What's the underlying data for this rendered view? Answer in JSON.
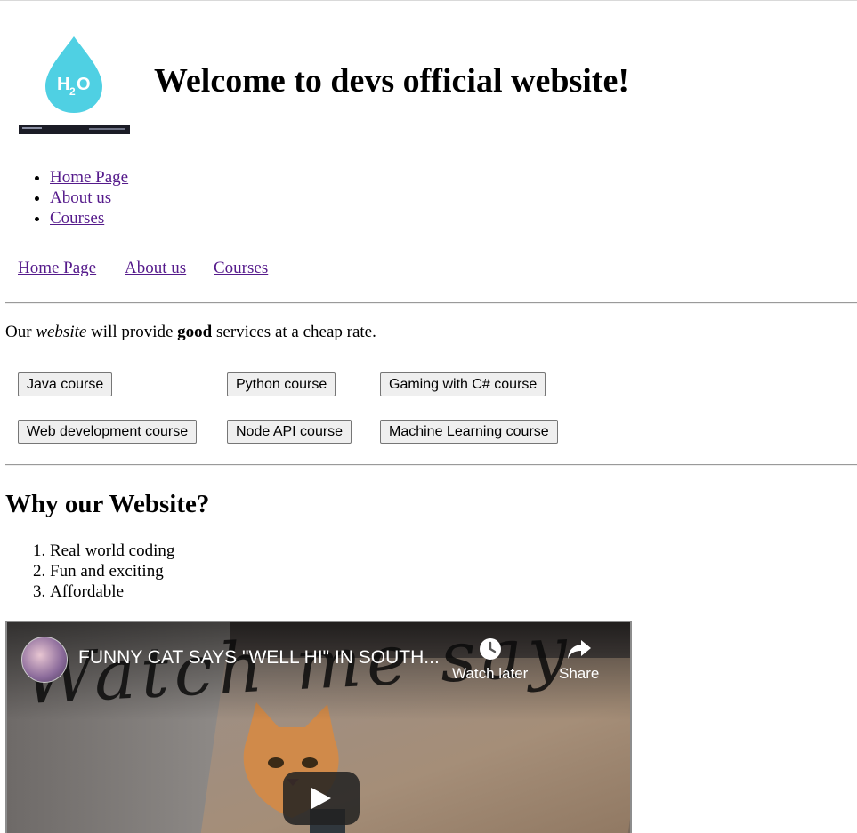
{
  "header": {
    "title": "Welcome to devs official website!",
    "logo_text": "H2O"
  },
  "nav_list": [
    {
      "label": "Home Page"
    },
    {
      "label": "About us"
    },
    {
      "label": "Courses"
    }
  ],
  "nav_inline": [
    {
      "label": "Home Page"
    },
    {
      "label": "About us"
    },
    {
      "label": "Courses"
    }
  ],
  "intro": {
    "part1": "Our ",
    "italic": "website",
    "part2": " will provide ",
    "bold": "good",
    "part3": " services at a cheap rate."
  },
  "courses": [
    {
      "label": "Java course"
    },
    {
      "label": "Python course"
    },
    {
      "label": "Gaming with C# course"
    },
    {
      "label": "Web development course"
    },
    {
      "label": "Node API course"
    },
    {
      "label": "Machine Learning course"
    }
  ],
  "why": {
    "heading": "Why our Website?",
    "items": [
      "Real world coding",
      "Fun and exciting",
      "Affordable"
    ]
  },
  "video": {
    "title": "FUNNY CAT SAYS \"WELL HI\" IN SOUTH...",
    "watch_later": "Watch later",
    "share": "Share",
    "watermark": "Watch me say"
  },
  "colors": {
    "link": "#551a8b",
    "logo_drop": "#4fd0e3"
  }
}
